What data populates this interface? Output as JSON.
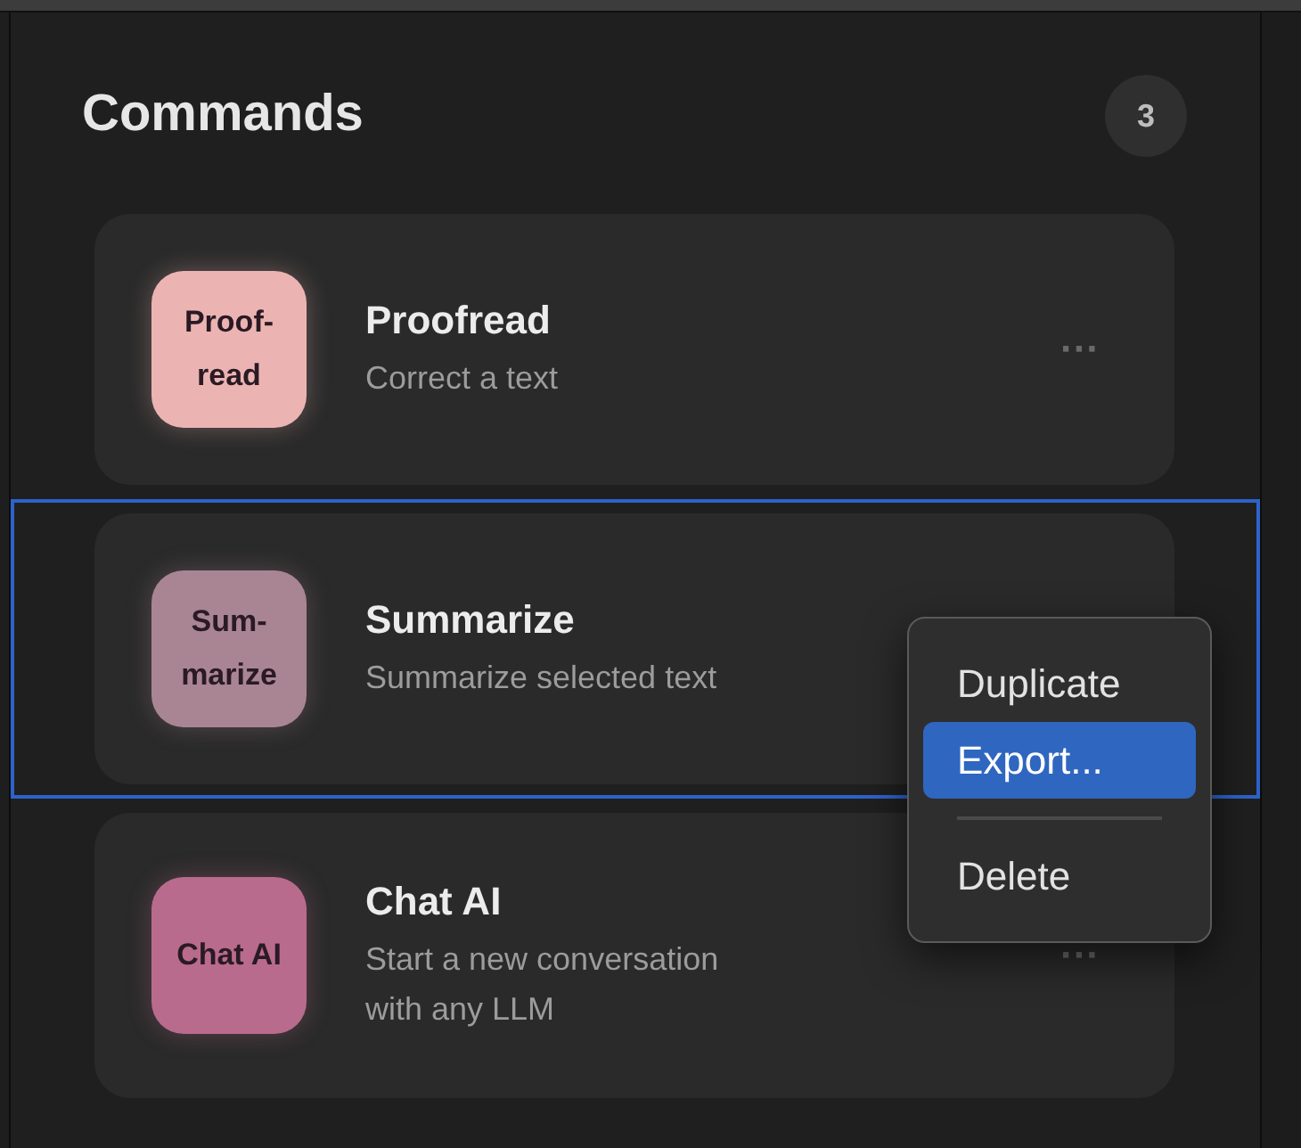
{
  "header": {
    "title": "Commands",
    "count": "3"
  },
  "commands": [
    {
      "tile": "Proof-\nread",
      "color": "#ebb4b2",
      "title": "Proofread",
      "subtitle": "Correct a text",
      "more": "···",
      "selected": false
    },
    {
      "tile": "Sum-\nmarize",
      "color": "#a98594",
      "title": "Summarize",
      "subtitle": "Summarize selected text",
      "selected": true
    },
    {
      "tile": "Chat AI",
      "color": "#b96b8d",
      "title": "Chat AI",
      "subtitle": "Start a new conversation\nwith any LLM",
      "more": "···",
      "selected": false
    }
  ],
  "context_menu": {
    "items": [
      {
        "kind": "item",
        "label": "Duplicate",
        "selected": false
      },
      {
        "kind": "item",
        "label": "Export...",
        "selected": true
      },
      {
        "kind": "separator"
      },
      {
        "kind": "item",
        "label": "Delete",
        "selected": false
      }
    ]
  }
}
